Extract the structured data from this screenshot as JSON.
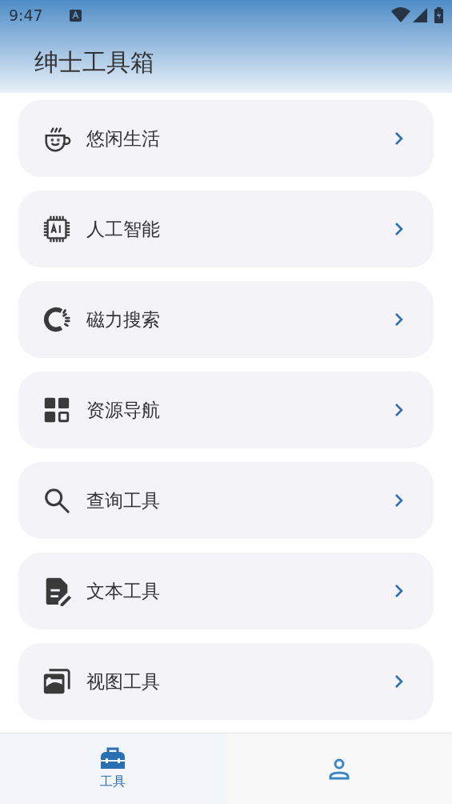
{
  "status_bar": {
    "time": "9:47"
  },
  "header": {
    "title": "绅士工具箱"
  },
  "menu": [
    {
      "label": "悠闲生活"
    },
    {
      "label": "人工智能"
    },
    {
      "label": "磁力搜索"
    },
    {
      "label": "资源导航"
    },
    {
      "label": "查询工具"
    },
    {
      "label": "文本工具"
    },
    {
      "label": "视图工具"
    }
  ],
  "bottom_nav": [
    {
      "label": "工具",
      "selected": true
    },
    {
      "selected": false
    }
  ]
}
